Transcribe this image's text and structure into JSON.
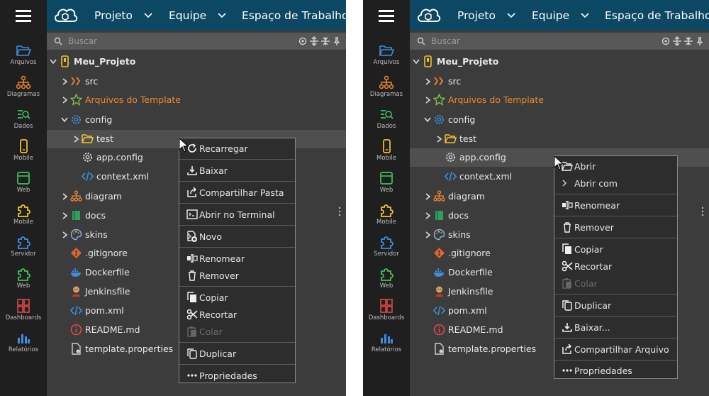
{
  "colors": {
    "topbar": "#0c4763",
    "activity_bg": "#1f1f1f",
    "explorer_bg": "#3c3c3c",
    "menu_bg": "#2d2d2d",
    "orange": "#f08830",
    "blue": "#3e8ee0",
    "green": "#44c060",
    "yellow": "#f2c232",
    "red": "#e04848"
  },
  "topbar": {
    "menus": [
      "Projeto",
      "Equipe",
      "Espaço de Trabalho"
    ]
  },
  "activity_bar": [
    {
      "label": "Arquivos",
      "icon": "folder-open-icon"
    },
    {
      "label": "Diagramas",
      "icon": "diagram-icon"
    },
    {
      "label": "Dados",
      "icon": "data-icon"
    },
    {
      "label": "Mobile",
      "icon": "mobile-icon"
    },
    {
      "label": "Web",
      "icon": "web-window-icon"
    },
    {
      "label": "Mobile",
      "icon": "puzzle-icon"
    },
    {
      "label": "Servidor",
      "icon": "puzzle-icon"
    },
    {
      "label": "Web",
      "icon": "puzzle-icon"
    },
    {
      "label": "Dashboards",
      "icon": "dashboard-icon"
    },
    {
      "label": "Relatórios",
      "icon": "chart-icon"
    }
  ],
  "search": {
    "placeholder": "Buscar"
  },
  "tree": {
    "root": "Meu_Projeto",
    "items": {
      "src": "src",
      "template": "Arquivos do Template",
      "config": "config",
      "test": "test",
      "app_config": "app.config",
      "context": "context.xml",
      "diagram": "diagram",
      "docs": "docs",
      "skins": "skins",
      "gitignore": ".gitignore",
      "dockerfile": "Dockerfile",
      "jenkinsfile": "Jenkinsfile",
      "pom": "pom.xml",
      "readme": "README.md",
      "template_props": "template.properties"
    }
  },
  "left_menu": {
    "reload": "Recarregar",
    "download": "Baixar",
    "share_folder": "Compartilhar Pasta",
    "terminal": "Abrir no Terminal",
    "new": "Novo",
    "rename": "Renomear",
    "remove": "Remover",
    "copy": "Copiar",
    "cut": "Recortar",
    "paste": "Colar",
    "duplicate": "Duplicar",
    "properties": "Propriedades"
  },
  "right_menu": {
    "open": "Abrir",
    "open_with": "Abrir com",
    "rename": "Renomear",
    "remove": "Remover",
    "copy": "Copiar",
    "cut": "Recortar",
    "paste": "Colar",
    "duplicate": "Duplicar",
    "download": "Baixar...",
    "share_file": "Compartilhar Arquivo",
    "properties": "Propriedades"
  }
}
